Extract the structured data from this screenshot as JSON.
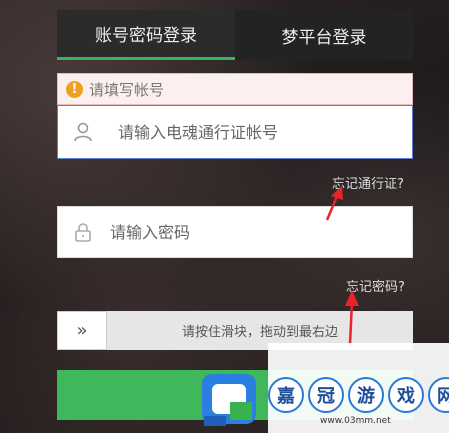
{
  "tabs": [
    {
      "label": "账号密码登录",
      "active": true
    },
    {
      "label": "梦平台登录",
      "active": false
    }
  ],
  "error": {
    "text": "请填写帐号",
    "icon": "warning-icon"
  },
  "account": {
    "placeholder": "请输入电魂通行证帐号",
    "icon": "user-icon"
  },
  "forgot_pass_id": "忘记通行证?",
  "password": {
    "placeholder": "请输入密码",
    "icon": "lock-icon"
  },
  "forgot_password": "忘记密码?",
  "slider": {
    "handle": "»",
    "text": "请按住滑块，拖动到最右边"
  },
  "submit": {
    "label": ""
  },
  "watermark": {
    "brand": [
      "嘉",
      "冠",
      "游",
      "戏",
      "网"
    ],
    "url": "www.03mm.net"
  },
  "colors": {
    "accent": "#3fb75b",
    "error_bg": "#fcefef",
    "focus_border": "#5a7fd0",
    "arrow": "#e8232a"
  }
}
